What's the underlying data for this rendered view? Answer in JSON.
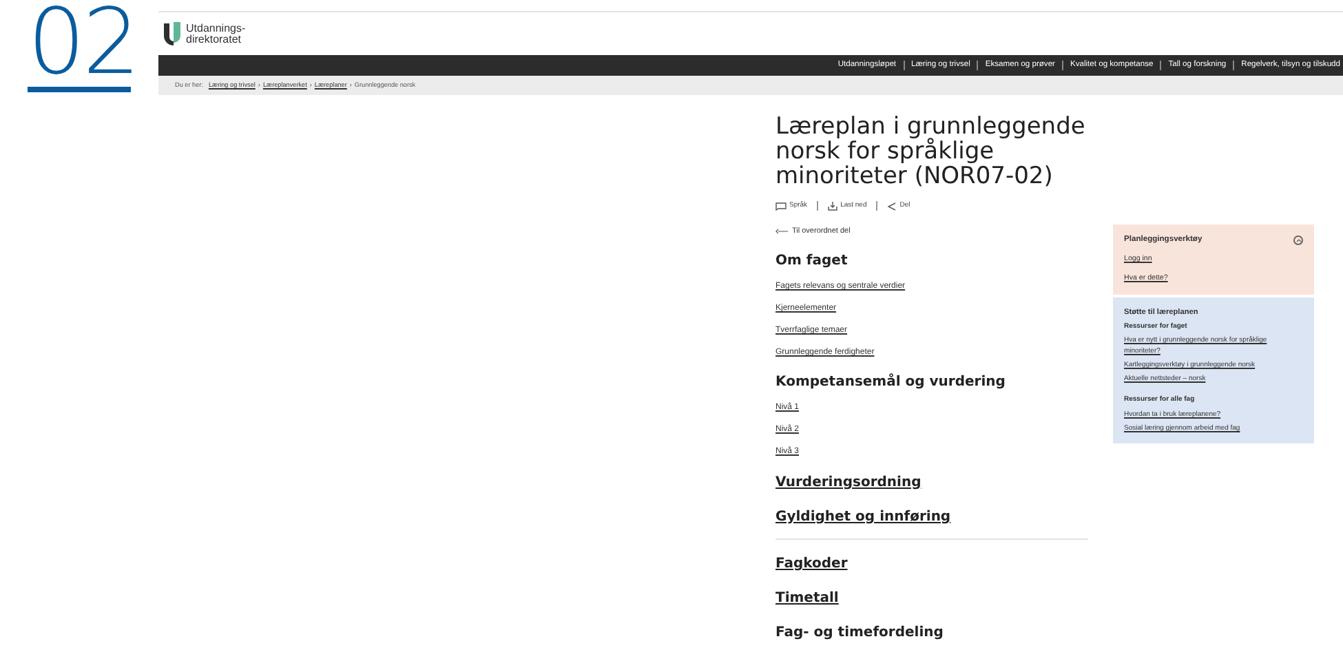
{
  "section_number": "02",
  "logo": {
    "text_line_1": "Utdannings-",
    "text_line_2": "direktoratet"
  },
  "nav": [
    "Utdanningsløpet",
    "Læring og trivsel",
    "Eksamen og prøver",
    "Kvalitet og kompetanse",
    "Tall og forskning",
    "Regelverk, tilsyn og tilskudd"
  ],
  "breadcrumb": {
    "label": "Du er her:",
    "separator": "›",
    "items": [
      {
        "text": "Læring og trivsel",
        "link": true
      },
      {
        "text": "Læreplanverket",
        "link": true
      },
      {
        "text": "Læreplaner",
        "link": true
      },
      {
        "text": "Grunnleggende norsk",
        "link": false
      }
    ]
  },
  "title": "Læreplan i grunnleggende norsk for språklige minoriteter (NOR07-02)",
  "actions": [
    {
      "label": "Språk",
      "kind": "language"
    },
    {
      "label": "Last ned",
      "kind": "download"
    },
    {
      "label": "Del",
      "kind": "share"
    }
  ],
  "back_link": "Til overordnet del",
  "sections": [
    {
      "kind": "group",
      "heading": "Om faget",
      "links": [
        "Fagets relevans og sentrale verdier",
        "Kjerneelementer",
        "Tverrfaglige temaer",
        "Grunnleggende ferdigheter"
      ]
    },
    {
      "kind": "group",
      "heading": "Kompetansemål og vurdering",
      "links": [
        "Nivå 1",
        "Nivå 2",
        "Nivå 3"
      ]
    },
    {
      "kind": "link",
      "heading": "Vurderingsordning"
    },
    {
      "kind": "link",
      "heading": "Gyldighet og innføring"
    },
    {
      "kind": "divider"
    },
    {
      "kind": "link",
      "heading": "Fagkoder"
    },
    {
      "kind": "link",
      "heading": "Timetall"
    },
    {
      "kind": "plain",
      "heading": "Fag- og timefordeling"
    }
  ],
  "planning": {
    "title": "Planleggingsverktøy",
    "expanded": true,
    "links": [
      "Logg inn",
      "Hva er dette?"
    ]
  },
  "support": {
    "title": "Støtte til læreplanen",
    "groups": [
      {
        "heading": "Ressurser for faget",
        "links": [
          "Hva er nytt i grunnleggende norsk for språklige minoriteter?",
          "Kartleggingsverktøy i grunnleggende norsk",
          "Aktuelle nettsteder – norsk"
        ]
      },
      {
        "heading": "Ressurser for alle fag",
        "links": [
          "Hvordan ta i bruk læreplanene?",
          "Sosial læring gjennom arbeid med fag"
        ]
      }
    ]
  }
}
